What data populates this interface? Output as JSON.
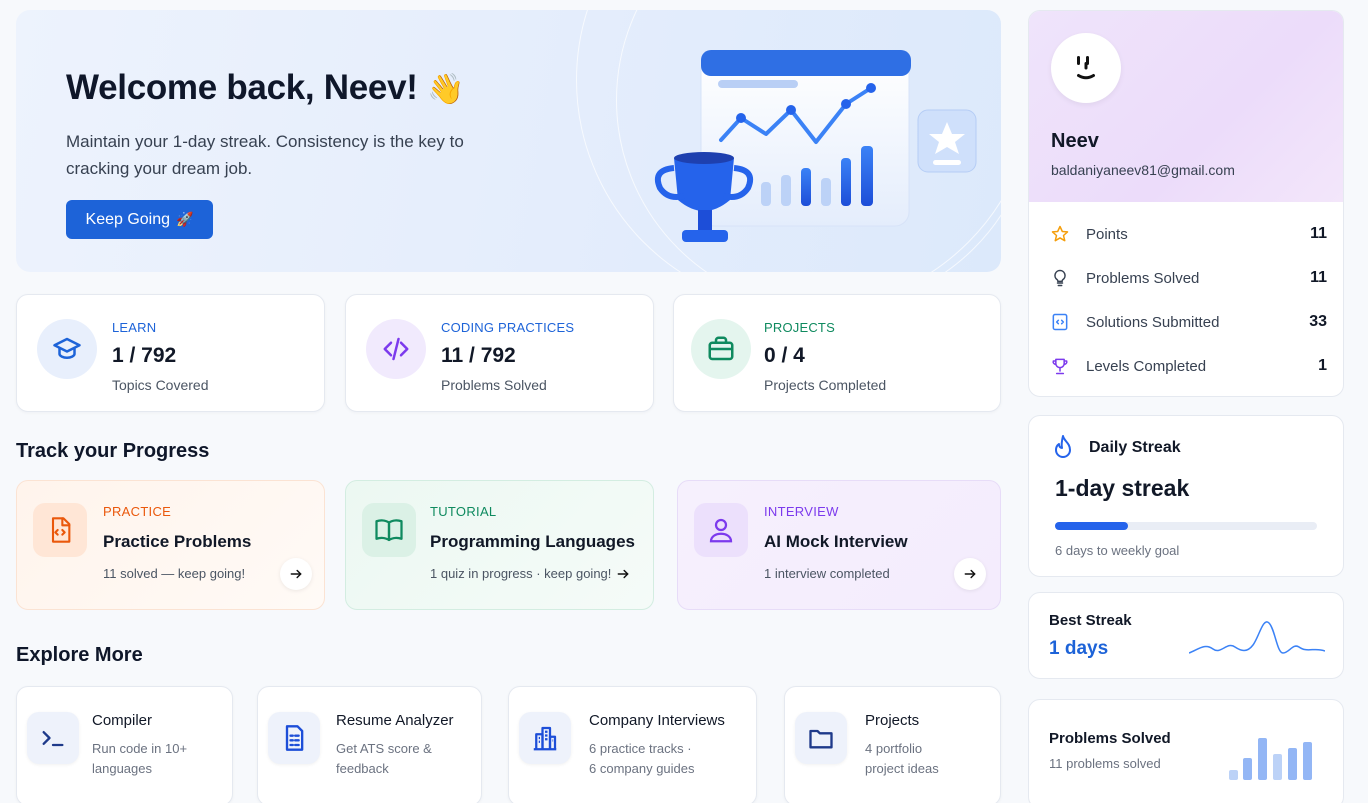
{
  "hero": {
    "title": "Welcome back, Neev!",
    "title_emoji": "👋",
    "subtitle": "Maintain your 1-day streak. Consistency is the key to cracking your dream job.",
    "button_label": "Keep Going",
    "button_emoji": "🚀"
  },
  "stats": [
    {
      "kicker": "LEARN",
      "value": "1 / 792",
      "caption": "Topics Covered",
      "color": "#1d63d8",
      "icon": "graduation-cap-icon"
    },
    {
      "kicker": "CODING PRACTICES",
      "value": "11 / 792",
      "caption": "Problems Solved",
      "color": "#7c3aed",
      "icon": "code-icon"
    },
    {
      "kicker": "PROJECTS",
      "value": "0 / 4",
      "caption": "Projects Completed",
      "color": "#059669",
      "icon": "briefcase-icon"
    }
  ],
  "track": {
    "title": "Track your Progress",
    "items": [
      {
        "kicker": "PRACTICE",
        "title": "Practice Problems",
        "desc": "11 solved — keep going!",
        "color": "#ea580c",
        "icon": "code-file-icon"
      },
      {
        "kicker": "TUTORIAL",
        "title": "Programming Languages",
        "desc": "1 quiz in progress · keep going!",
        "color": "#0f8a5f",
        "icon": "book-icon"
      },
      {
        "kicker": "INTERVIEW",
        "title": "AI Mock Interview",
        "desc": "1 interview completed",
        "color": "#7c3aed",
        "icon": "user-icon"
      }
    ]
  },
  "explore": {
    "title": "Explore More",
    "items": [
      {
        "title": "Compiler",
        "desc_line1": "Run code in 10+",
        "desc_line2": "languages",
        "icon": "terminal-icon"
      },
      {
        "title": "Resume Analyzer",
        "desc_line1": "Get ATS score &",
        "desc_line2": "feedback",
        "icon": "document-icon"
      },
      {
        "title": "Company Interviews",
        "desc_line1": "6 practice tracks ·",
        "desc_line2": "6 company guides",
        "icon": "building-icon"
      },
      {
        "title": "Projects",
        "desc_line1": "4 portfolio",
        "desc_line2": "project ideas",
        "icon": "folder-icon"
      }
    ]
  },
  "profile": {
    "name": "Neev",
    "email": "baldaniyaneev81@gmail.com",
    "stats": [
      {
        "label": "Points",
        "value": "11",
        "icon": "star-icon"
      },
      {
        "label": "Problems Solved",
        "value": "11",
        "icon": "lightbulb-icon"
      },
      {
        "label": "Solutions Submitted",
        "value": "33",
        "icon": "code-doc-icon"
      },
      {
        "label": "Levels Completed",
        "value": "1",
        "icon": "trophy-icon"
      }
    ]
  },
  "daily_streak": {
    "title": "Daily Streak",
    "value": "1-day streak",
    "progress": 0.28,
    "caption": "6 days to weekly goal"
  },
  "best_streak": {
    "title": "Best Streak",
    "value": "1 days"
  },
  "problems_solved": {
    "title": "Problems Solved",
    "caption": "11 problems solved"
  },
  "colors": {
    "accent": "#1d63d8",
    "text": "#111827",
    "muted": "#4b5563"
  }
}
